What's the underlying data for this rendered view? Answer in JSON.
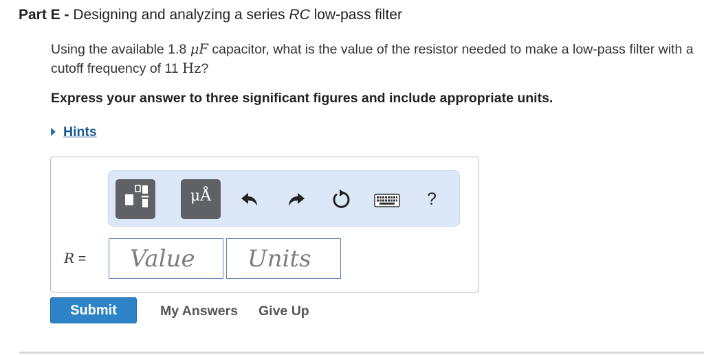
{
  "part": {
    "label": "Part E",
    "separator": " - ",
    "title_pre": "Designing and analyzing a series ",
    "title_italic": "RC",
    "title_post": " low-pass filter"
  },
  "question": {
    "t1": "Using the available 1.8 ",
    "mu": "μ",
    "F": "F",
    "t2": " capacitor, what is the value of the resistor needed to make a low-pass filter with a cutoff frequency of 11 ",
    "hz": "Hz",
    "t3": "?"
  },
  "instruction": "Express your answer to three significant figures and include appropriate units.",
  "hints": {
    "label": "Hints"
  },
  "toolbar": {
    "units_glyph": "μÅ",
    "help_label": "?",
    "icons": {
      "templates": "templates-icon",
      "units": "units-icon",
      "undo": "undo-icon",
      "redo": "redo-icon",
      "reset": "reset-icon",
      "keyboard": "keyboard-icon",
      "help": "help-icon"
    }
  },
  "answer": {
    "variable": "R",
    "equals": " =",
    "value_placeholder": "Value",
    "units_placeholder": "Units"
  },
  "actions": {
    "submit": "Submit",
    "my_answers": "My Answers",
    "give_up": "Give Up"
  },
  "colors": {
    "toolbar_bg": "#dce8f7",
    "button_dark": "#5f6166",
    "submit_bg": "#2e83c8",
    "link": "#1a5a96"
  }
}
